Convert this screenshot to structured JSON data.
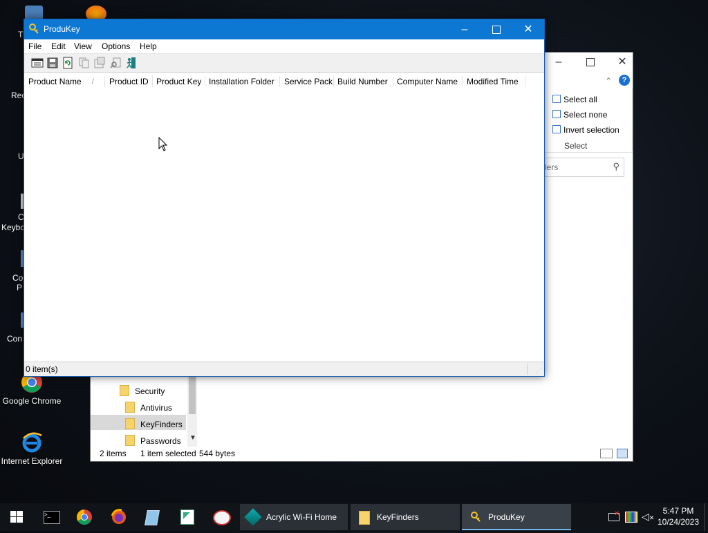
{
  "desktop": {
    "icons": [
      {
        "name": "google-chrome-desktop-icon",
        "label": "Google Chrome"
      },
      {
        "name": "internet-explorer-desktop-icon",
        "label": "Internet Explorer"
      }
    ],
    "partial_labels": [
      "T",
      "Rec",
      "U",
      "C",
      "Keybo",
      "Co",
      "P",
      "Con"
    ]
  },
  "explorer": {
    "ribbon": {
      "select_all": "Select all",
      "select_none": "Select none",
      "invert_selection": "Invert selection",
      "group_label": "Select"
    },
    "search_placeholder": "lers",
    "nav": [
      {
        "label": "Security",
        "selected": false
      },
      {
        "label": "Antivirus",
        "selected": false
      },
      {
        "label": "KeyFinders",
        "selected": true
      },
      {
        "label": "Passwords",
        "selected": false
      }
    ],
    "status": {
      "items": "2 items",
      "selected": "1 item selected",
      "size": "544 bytes"
    }
  },
  "produkey": {
    "title": "ProduKey",
    "menu": [
      "File",
      "Edit",
      "View",
      "Options",
      "Help"
    ],
    "columns": [
      "Product Name",
      "Product ID",
      "Product Key",
      "Installation Folder",
      "Service Pack",
      "Build Number",
      "Computer Name",
      "Modified Time"
    ],
    "sort_indicator": "/",
    "status": "0 item(s)"
  },
  "taskbar": {
    "apps": [
      {
        "label": "Acrylic Wi-Fi Home",
        "active": false
      },
      {
        "label": "KeyFinders",
        "active": false
      },
      {
        "label": "ProduKey",
        "active": true
      }
    ],
    "time": "5:47 PM",
    "date": "10/24/2023"
  },
  "colors": {
    "titlebar": "#0c78d4",
    "taskbar": "#101317",
    "accent": "#76b9ed"
  }
}
